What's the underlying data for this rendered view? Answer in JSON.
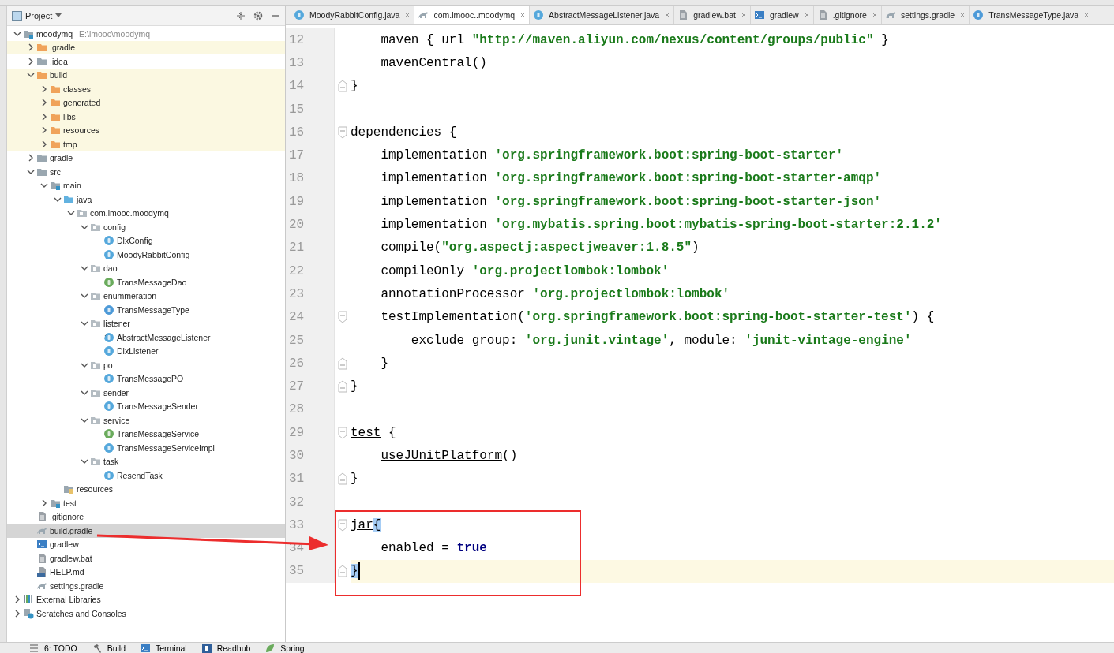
{
  "project_panel": {
    "title": "Project",
    "tree": [
      {
        "label": "moodymq",
        "path": "E:\\imooc\\moodymq",
        "kind": "module",
        "expanded": true,
        "excluded": false,
        "selected": false,
        "children": [
          {
            "label": ".gradle",
            "kind": "excludedfolder",
            "expanded": false,
            "excluded": true,
            "selected": false
          },
          {
            "label": ".idea",
            "kind": "folder",
            "expanded": false,
            "excluded": false,
            "selected": false
          },
          {
            "label": "build",
            "kind": "excludedfolder",
            "expanded": true,
            "excluded": true,
            "selected": false,
            "children": [
              {
                "label": "classes",
                "kind": "excludedfolder",
                "expanded": false,
                "excluded": true,
                "selected": false
              },
              {
                "label": "generated",
                "kind": "excludedfolder",
                "expanded": false,
                "excluded": true,
                "selected": false
              },
              {
                "label": "libs",
                "kind": "excludedfolder",
                "expanded": false,
                "excluded": true,
                "selected": false
              },
              {
                "label": "resources",
                "kind": "excludedfolder",
                "expanded": false,
                "excluded": true,
                "selected": false
              },
              {
                "label": "tmp",
                "kind": "excludedfolder",
                "expanded": false,
                "excluded": true,
                "selected": false
              }
            ]
          },
          {
            "label": "gradle",
            "kind": "folder",
            "expanded": false,
            "excluded": false,
            "selected": false
          },
          {
            "label": "src",
            "kind": "folder",
            "expanded": true,
            "excluded": false,
            "selected": false,
            "children": [
              {
                "label": "main",
                "kind": "modulefolder",
                "expanded": true,
                "excluded": false,
                "selected": false,
                "children": [
                  {
                    "label": "java",
                    "kind": "sourcefolder",
                    "expanded": true,
                    "excluded": false,
                    "selected": false,
                    "children": [
                      {
                        "label": "com.imooc.moodymq",
                        "kind": "package",
                        "expanded": true,
                        "excluded": false,
                        "selected": false,
                        "children": [
                          {
                            "label": "config",
                            "kind": "package",
                            "expanded": true,
                            "excluded": false,
                            "selected": false,
                            "children": [
                              {
                                "label": "DlxConfig",
                                "kind": "class",
                                "excluded": false,
                                "selected": false
                              },
                              {
                                "label": "MoodyRabbitConfig",
                                "kind": "class",
                                "excluded": false,
                                "selected": false
                              }
                            ]
                          },
                          {
                            "label": "dao",
                            "kind": "package",
                            "expanded": true,
                            "excluded": false,
                            "selected": false,
                            "children": [
                              {
                                "label": "TransMessageDao",
                                "kind": "interface",
                                "excluded": false,
                                "selected": false
                              }
                            ]
                          },
                          {
                            "label": "enummeration",
                            "kind": "package",
                            "expanded": true,
                            "excluded": false,
                            "selected": false,
                            "children": [
                              {
                                "label": "TransMessageType",
                                "kind": "enum",
                                "excluded": false,
                                "selected": false
                              }
                            ]
                          },
                          {
                            "label": "listener",
                            "kind": "package",
                            "expanded": true,
                            "excluded": false,
                            "selected": false,
                            "children": [
                              {
                                "label": "AbstractMessageListener",
                                "kind": "abstract",
                                "excluded": false,
                                "selected": false
                              },
                              {
                                "label": "DlxListener",
                                "kind": "class",
                                "excluded": false,
                                "selected": false
                              }
                            ]
                          },
                          {
                            "label": "po",
                            "kind": "package",
                            "expanded": true,
                            "excluded": false,
                            "selected": false,
                            "children": [
                              {
                                "label": "TransMessagePO",
                                "kind": "class",
                                "excluded": false,
                                "selected": false
                              }
                            ]
                          },
                          {
                            "label": "sender",
                            "kind": "package",
                            "expanded": true,
                            "excluded": false,
                            "selected": false,
                            "children": [
                              {
                                "label": "TransMessageSender",
                                "kind": "class",
                                "excluded": false,
                                "selected": false
                              }
                            ]
                          },
                          {
                            "label": "service",
                            "kind": "package",
                            "expanded": true,
                            "excluded": false,
                            "selected": false,
                            "children": [
                              {
                                "label": "TransMessageService",
                                "kind": "interface",
                                "excluded": false,
                                "selected": false
                              },
                              {
                                "label": "TransMessageServiceImpl",
                                "kind": "class",
                                "excluded": false,
                                "selected": false
                              }
                            ]
                          },
                          {
                            "label": "task",
                            "kind": "package",
                            "expanded": true,
                            "excluded": false,
                            "selected": false,
                            "children": [
                              {
                                "label": "ResendTask",
                                "kind": "class",
                                "excluded": false,
                                "selected": false
                              }
                            ]
                          }
                        ]
                      }
                    ]
                  },
                  {
                    "label": "resources",
                    "kind": "resourcesfolder",
                    "excluded": false,
                    "selected": false
                  }
                ]
              },
              {
                "label": "test",
                "kind": "modulefolder",
                "expanded": false,
                "excluded": false,
                "selected": false
              }
            ]
          },
          {
            "label": ".gitignore",
            "kind": "file",
            "excluded": false,
            "selected": false
          },
          {
            "label": "build.gradle",
            "kind": "gradle",
            "excluded": false,
            "selected": true
          },
          {
            "label": "gradlew",
            "kind": "terminal",
            "excluded": false,
            "selected": false
          },
          {
            "label": "gradlew.bat",
            "kind": "file",
            "excluded": false,
            "selected": false
          },
          {
            "label": "HELP.md",
            "kind": "markdown",
            "excluded": false,
            "selected": false
          },
          {
            "label": "settings.gradle",
            "kind": "gradle",
            "excluded": false,
            "selected": false
          }
        ]
      },
      {
        "label": "External Libraries",
        "kind": "libraries",
        "expanded": false,
        "excluded": false,
        "selected": false
      },
      {
        "label": "Scratches and Consoles",
        "kind": "scratches",
        "expanded": false,
        "excluded": false,
        "selected": false
      }
    ]
  },
  "tabs": [
    {
      "label": "MoodyRabbitConfig.java",
      "kind": "class",
      "selected": false
    },
    {
      "label": "com.imooc..moodymq",
      "kind": "gradle",
      "selected": true
    },
    {
      "label": "AbstractMessageListener.java",
      "kind": "class",
      "selected": false
    },
    {
      "label": "gradlew.bat",
      "kind": "file",
      "selected": false
    },
    {
      "label": "gradlew",
      "kind": "terminal",
      "selected": false
    },
    {
      "label": ".gitignore",
      "kind": "file",
      "selected": false
    },
    {
      "label": "settings.gradle",
      "kind": "gradle",
      "selected": false
    },
    {
      "label": "TransMessageType.java",
      "kind": "enum",
      "selected": false
    }
  ],
  "editor": {
    "lines": [
      {
        "num": "12",
        "kind": "plain",
        "current": false,
        "tokens": [
          {
            "kind": "plain",
            "text": "    maven { url "
          },
          {
            "kind": "string",
            "text": "\"http://maven.aliyun.com/nexus/content/groups/public\""
          },
          {
            "kind": "plain",
            "text": " }"
          }
        ]
      },
      {
        "num": "13",
        "kind": "plain",
        "current": false,
        "tokens": [
          {
            "kind": "plain",
            "text": "    mavenCentral()"
          }
        ]
      },
      {
        "num": "14",
        "kind": "closer",
        "current": false,
        "tokens": [
          {
            "kind": "plain",
            "text": "}"
          }
        ]
      },
      {
        "num": "15",
        "kind": "plain",
        "current": false
      },
      {
        "num": "16",
        "kind": "opener",
        "current": false,
        "tokens": [
          {
            "kind": "plain",
            "text": "dependencies {"
          }
        ]
      },
      {
        "num": "17",
        "kind": "plain",
        "current": false,
        "tokens": [
          {
            "kind": "plain",
            "text": "    implementation "
          },
          {
            "kind": "string",
            "text": "'org.springframework.boot:spring-boot-starter'"
          }
        ]
      },
      {
        "num": "18",
        "kind": "plain",
        "current": false,
        "tokens": [
          {
            "kind": "plain",
            "text": "    implementation "
          },
          {
            "kind": "string",
            "text": "'org.springframework.boot:spring-boot-starter-amqp'"
          }
        ]
      },
      {
        "num": "19",
        "kind": "plain",
        "current": false,
        "tokens": [
          {
            "kind": "plain",
            "text": "    implementation "
          },
          {
            "kind": "string",
            "text": "'org.springframework.boot:spring-boot-starter-json'"
          }
        ]
      },
      {
        "num": "20",
        "kind": "plain",
        "current": false,
        "tokens": [
          {
            "kind": "plain",
            "text": "    implementation "
          },
          {
            "kind": "string",
            "text": "'org.mybatis.spring.boot:mybatis-spring-boot-starter:2.1.2'"
          }
        ]
      },
      {
        "num": "21",
        "kind": "plain",
        "current": false,
        "tokens": [
          {
            "kind": "plain",
            "text": "    compile("
          },
          {
            "kind": "string",
            "text": "\"org.aspectj:aspectjweaver:1.8.5\""
          },
          {
            "kind": "plain",
            "text": ")"
          }
        ]
      },
      {
        "num": "22",
        "kind": "plain",
        "current": false,
        "tokens": [
          {
            "kind": "plain",
            "text": "    compileOnly "
          },
          {
            "kind": "string",
            "text": "'org.projectlombok:lombok'"
          }
        ]
      },
      {
        "num": "23",
        "kind": "plain",
        "current": false,
        "tokens": [
          {
            "kind": "plain",
            "text": "    annotationProcessor "
          },
          {
            "kind": "string",
            "text": "'org.projectlombok:lombok'"
          }
        ]
      },
      {
        "num": "24",
        "kind": "opener",
        "current": false,
        "tokens": [
          {
            "kind": "plain",
            "text": "    testImplementation("
          },
          {
            "kind": "string",
            "text": "'org.springframework.boot:spring-boot-starter-test'"
          },
          {
            "kind": "plain",
            "text": ") {"
          }
        ]
      },
      {
        "num": "25",
        "kind": "plain",
        "current": false,
        "tokens": [
          {
            "kind": "underlined",
            "text": "        exclude"
          },
          {
            "kind": "plain",
            "text": " group: "
          },
          {
            "kind": "string",
            "text": "'org.junit.vintage'"
          },
          {
            "kind": "plain",
            "text": ", module: "
          },
          {
            "kind": "string",
            "text": "'junit-vintage-engine'"
          }
        ]
      },
      {
        "num": "26",
        "kind": "closer",
        "current": false,
        "tokens": [
          {
            "kind": "plain",
            "text": "    }"
          }
        ]
      },
      {
        "num": "27",
        "kind": "closer",
        "current": false,
        "tokens": [
          {
            "kind": "plain",
            "text": "}"
          }
        ]
      },
      {
        "num": "28",
        "kind": "plain",
        "current": false
      },
      {
        "num": "29",
        "kind": "opener",
        "current": false,
        "tokens": [
          {
            "kind": "underlined",
            "text": "test"
          },
          {
            "kind": "plain",
            "text": " {"
          }
        ]
      },
      {
        "num": "30",
        "kind": "plain",
        "current": false,
        "tokens": [
          {
            "kind": "underlined",
            "text": "    useJUnitPlatform"
          },
          {
            "kind": "plain",
            "text": "()"
          }
        ]
      },
      {
        "num": "31",
        "kind": "closer",
        "current": false,
        "tokens": [
          {
            "kind": "plain",
            "text": "}"
          }
        ]
      },
      {
        "num": "32",
        "kind": "plain",
        "current": false
      },
      {
        "num": "33",
        "kind": "opener",
        "current": false,
        "tokens": [
          {
            "kind": "underlined",
            "text": "jar"
          },
          {
            "kind": "matched",
            "text": "{"
          }
        ]
      },
      {
        "num": "34",
        "kind": "plain",
        "current": false,
        "tokens": [
          {
            "kind": "plain",
            "text": "    enabled = "
          },
          {
            "kind": "keyword",
            "text": "true"
          }
        ]
      },
      {
        "num": "35",
        "kind": "closer",
        "current": true,
        "tokens": [
          {
            "kind": "matched",
            "text": "}"
          }
        ]
      }
    ]
  },
  "bottom_bar": [
    {
      "label": "6: TODO",
      "kind": "list"
    },
    {
      "label": "Build",
      "kind": "hammer"
    },
    {
      "label": "Terminal",
      "kind": "terminal"
    },
    {
      "label": "Readhub",
      "kind": "letter"
    },
    {
      "label": "Spring",
      "kind": "leaf"
    }
  ]
}
